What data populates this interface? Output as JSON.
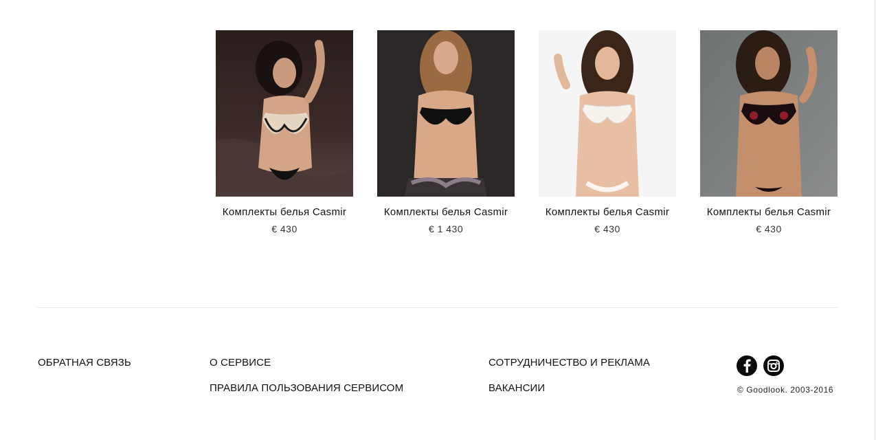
{
  "products": [
    {
      "title": "Комплекты белья Casmir",
      "price": "€ 430"
    },
    {
      "title": "Комплекты белья Casmir",
      "price": "€ 1 430"
    },
    {
      "title": "Комплекты белья Casmir",
      "price": "€ 430"
    },
    {
      "title": "Комплекты белья Casmir",
      "price": "€ 430"
    }
  ],
  "footer": {
    "feedback": "ОБРАТНАЯ СВЯЗЬ",
    "about": "О СЕРВИСЕ",
    "terms": "ПРАВИЛА ПОЛЬЗОВАНИЯ СЕРВИСОМ",
    "partnership": "СОТРУДНИЧЕСТВО И РЕКЛАМА",
    "vacancies": "ВАКАНСИИ",
    "social_icons": [
      "facebook-icon",
      "instagram-icon"
    ],
    "copyright": "© Goodlook. 2003-2016"
  }
}
